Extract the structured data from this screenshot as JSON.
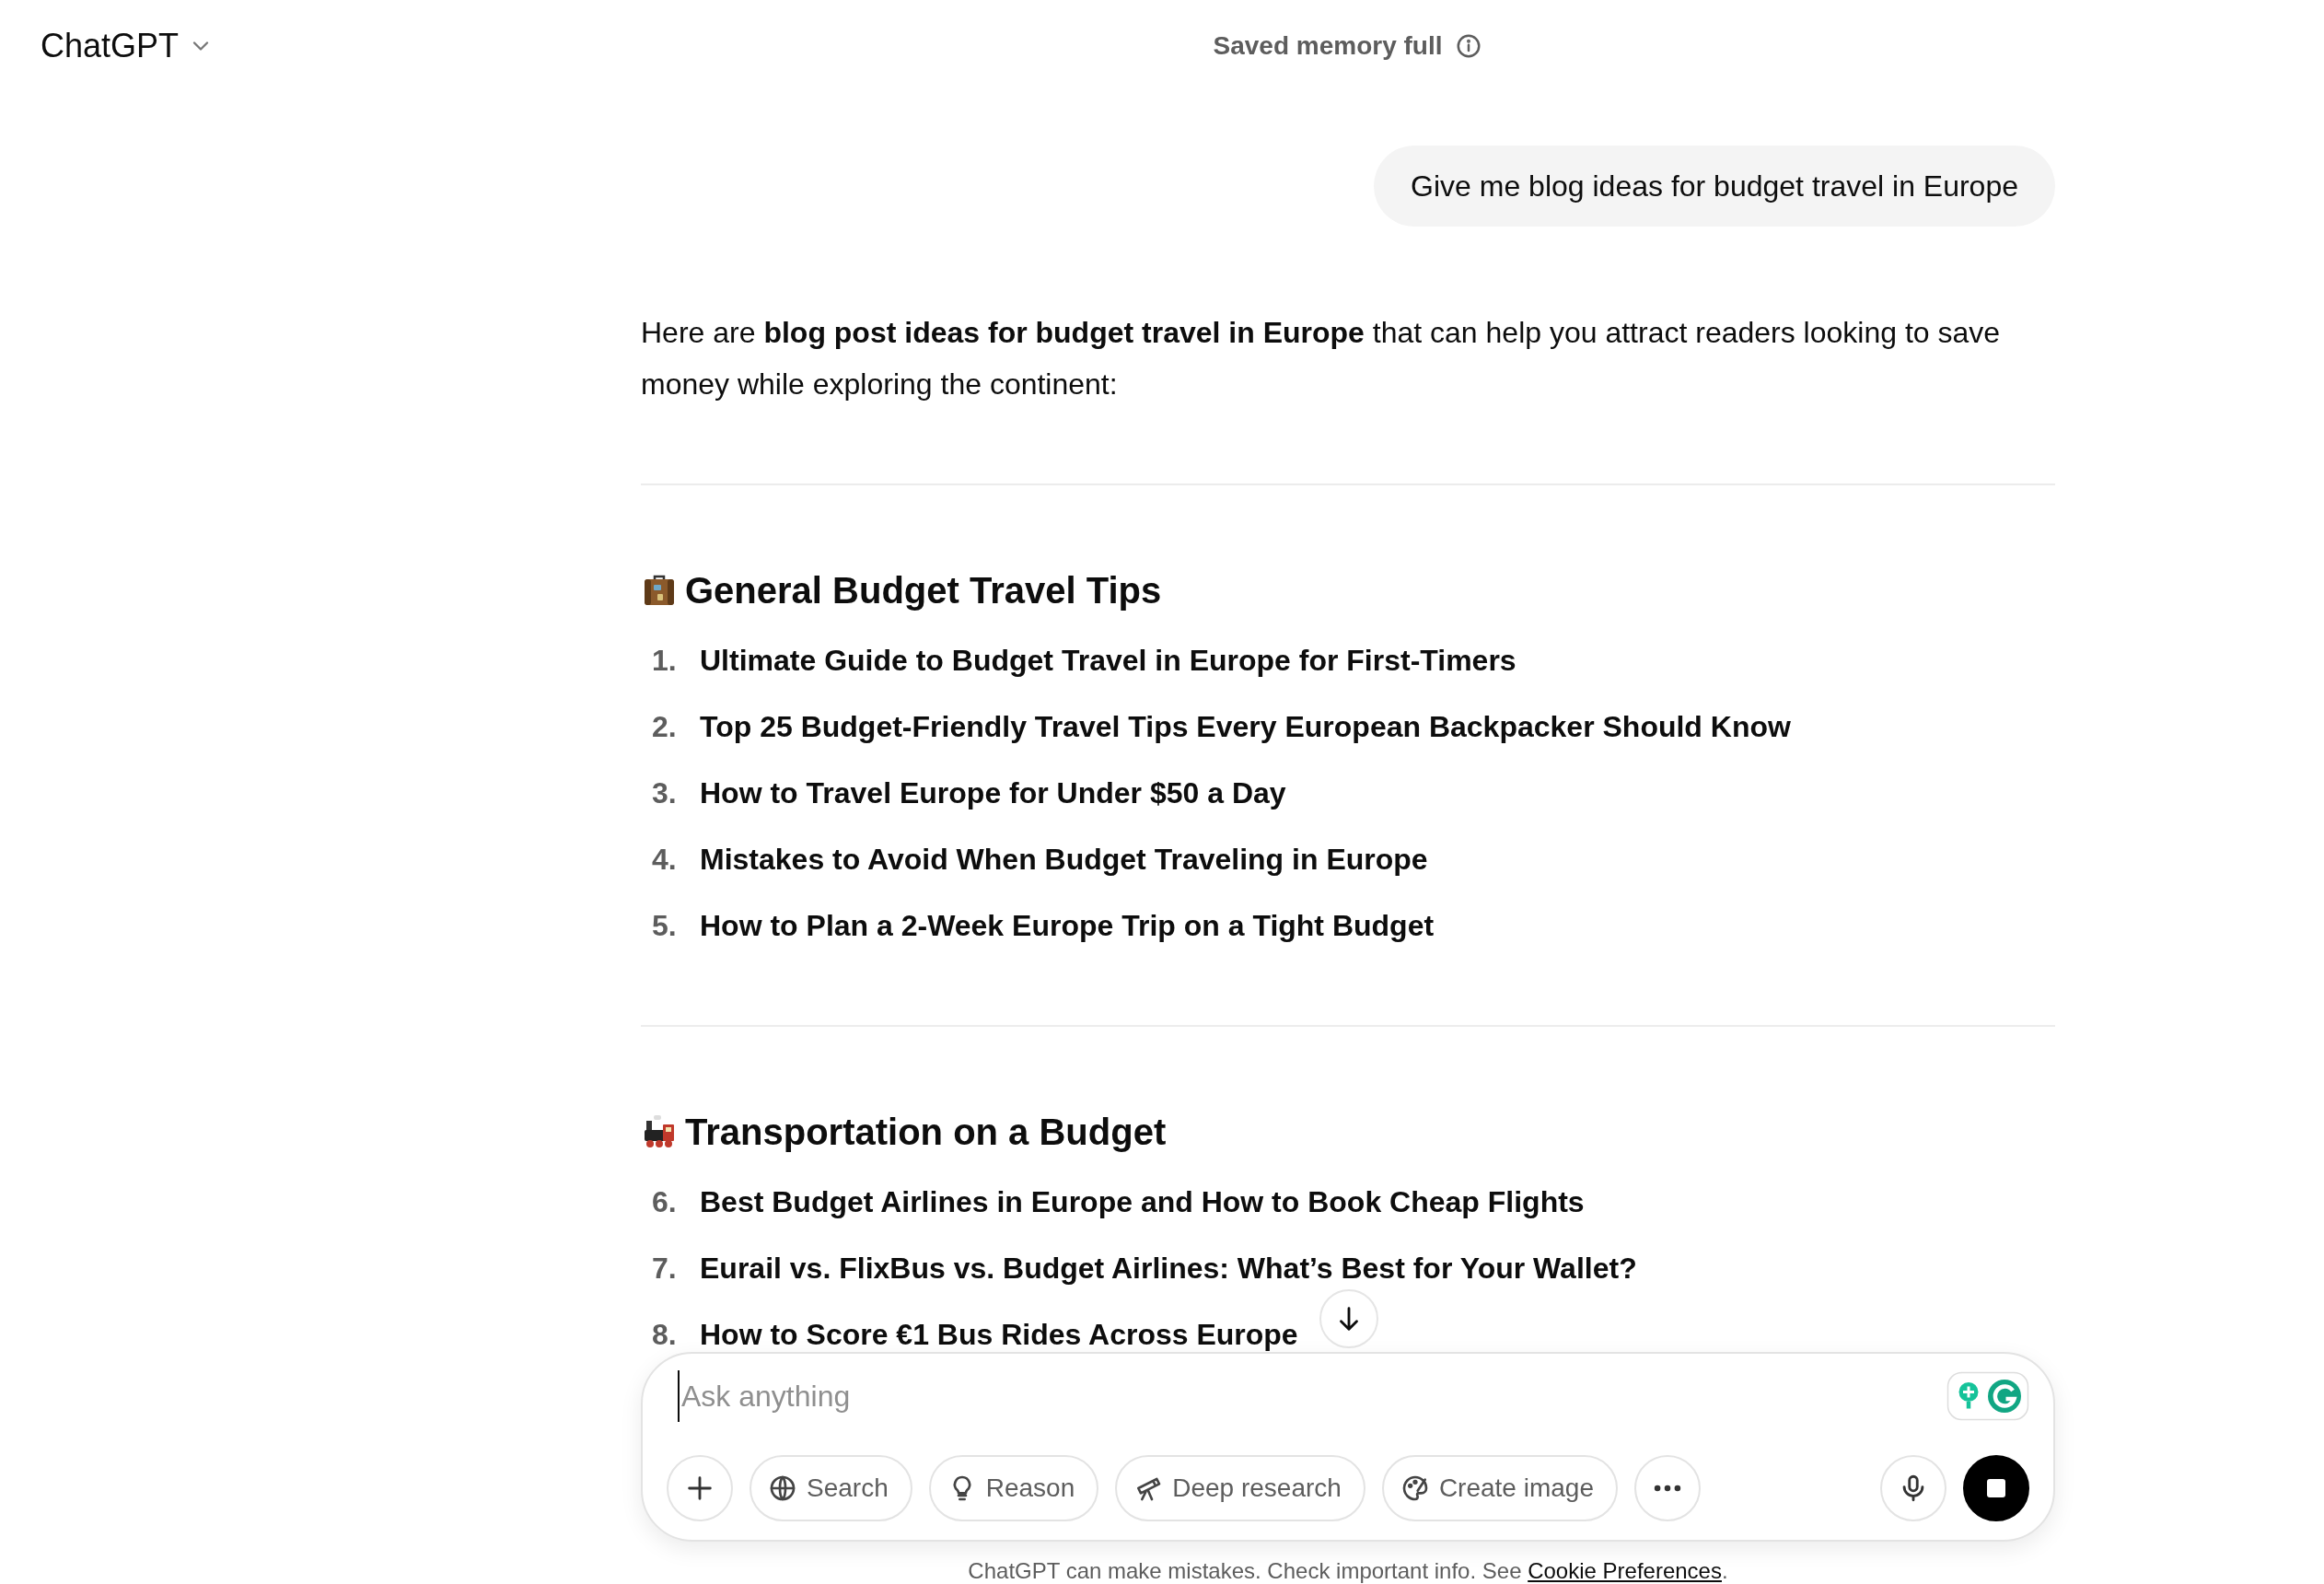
{
  "header": {
    "model": "ChatGPT",
    "memory_notice": "Saved memory full"
  },
  "user_message": "Give me blog ideas for budget travel in Europe",
  "response": {
    "intro": "Here are **blog post ideas for budget travel in Europe** that can help you attract readers looking to save money while exploring the continent:",
    "sections": [
      {
        "kind": "suitcase",
        "heading": "General Budget Travel Tips",
        "items": [
          {
            "number": "1.",
            "text": "Ultimate Guide to Budget Travel in Europe for First-Timers"
          },
          {
            "number": "2.",
            "text": "Top 25 Budget-Friendly Travel Tips Every European Backpacker Should Know"
          },
          {
            "number": "3.",
            "text": "How to Travel Europe for Under $50 a Day"
          },
          {
            "number": "4.",
            "text": "Mistakes to Avoid When Budget Traveling in Europe"
          },
          {
            "number": "5.",
            "text": "How to Plan a 2-Week Europe Trip on a Tight Budget"
          }
        ]
      },
      {
        "kind": "locomotive",
        "heading": "Transportation on a Budget",
        "items": [
          {
            "number": "6.",
            "text": "Best Budget Airlines in Europe and How to Book Cheap Flights"
          },
          {
            "number": "7.",
            "text": "Eurail vs. FlixBus vs. Budget Airlines: What’s Best for Your Wallet?"
          },
          {
            "number": "8.",
            "text": "How to Score €1 Bus Rides Across Europe"
          }
        ]
      }
    ]
  },
  "composer": {
    "placeholder": "Ask anything",
    "tools": [
      {
        "kind": "globe",
        "label": "Search"
      },
      {
        "kind": "bulb",
        "label": "Reason"
      },
      {
        "kind": "telescope",
        "label": "Deep research"
      },
      {
        "kind": "palette",
        "label": "Create image"
      }
    ]
  },
  "footer": {
    "text": "ChatGPT can make mistakes. Check important info. See",
    "link": "Cookie Preferences",
    "end": "."
  }
}
